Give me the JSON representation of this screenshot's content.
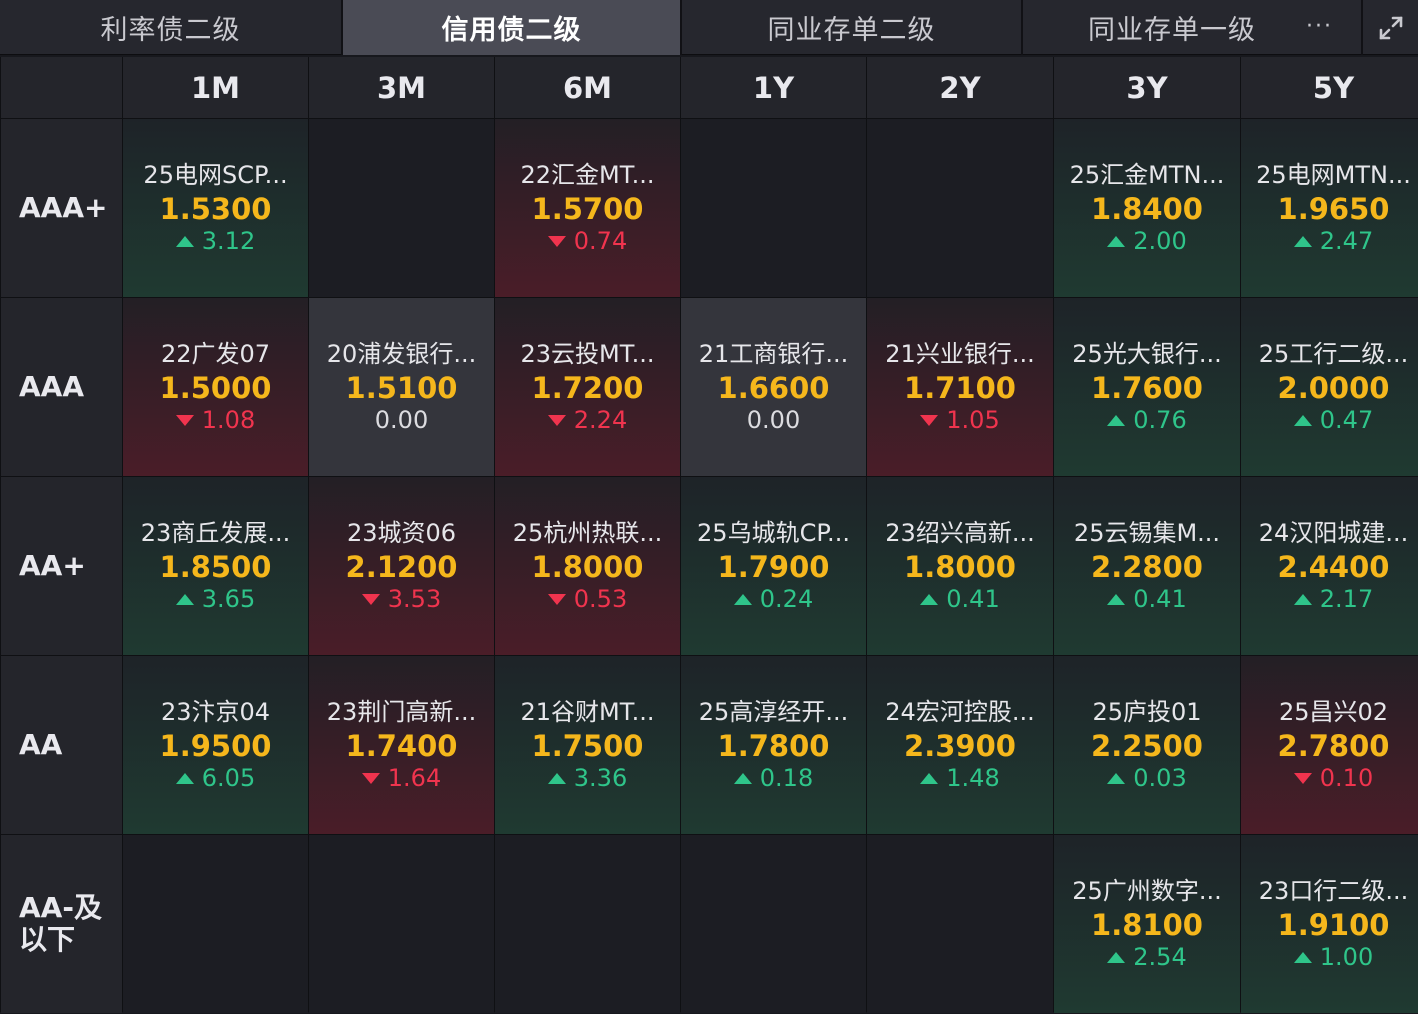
{
  "tabs": [
    "利率债二级",
    "信用债二级",
    "同业存单二级",
    "同业存单一级"
  ],
  "active_tab": 1,
  "more_label": "···",
  "icons": {
    "more": "more-dots-icon",
    "expand": "expand-icon"
  },
  "colors": {
    "value": "#f5b71c",
    "up": "#2fc58a",
    "down": "#f0344e"
  },
  "columns": [
    "1M",
    "3M",
    "6M",
    "1Y",
    "2Y",
    "3Y",
    "5Y"
  ],
  "rows": [
    {
      "label": "AAA+",
      "cells": [
        {
          "name": "25电网SCP...",
          "value": "1.5300",
          "change": "3.12",
          "dir": "up"
        },
        null,
        {
          "name": "22汇金MT...",
          "value": "1.5700",
          "change": "0.74",
          "dir": "down"
        },
        null,
        null,
        {
          "name": "25汇金MTN...",
          "value": "1.8400",
          "change": "2.00",
          "dir": "up"
        },
        {
          "name": "25电网MTN...",
          "value": "1.9650",
          "change": "2.47",
          "dir": "up"
        }
      ]
    },
    {
      "label": "AAA",
      "cells": [
        {
          "name": "22广发07",
          "value": "1.5000",
          "change": "1.08",
          "dir": "down"
        },
        {
          "name": "20浦发银行...",
          "value": "1.5100",
          "change": "0.00",
          "dir": "flat"
        },
        {
          "name": "23云投MT...",
          "value": "1.7200",
          "change": "2.24",
          "dir": "down"
        },
        {
          "name": "21工商银行...",
          "value": "1.6600",
          "change": "0.00",
          "dir": "flat"
        },
        {
          "name": "21兴业银行...",
          "value": "1.7100",
          "change": "1.05",
          "dir": "down"
        },
        {
          "name": "25光大银行...",
          "value": "1.7600",
          "change": "0.76",
          "dir": "up"
        },
        {
          "name": "25工行二级...",
          "value": "2.0000",
          "change": "0.47",
          "dir": "up"
        }
      ]
    },
    {
      "label": "AA+",
      "cells": [
        {
          "name": "23商丘发展...",
          "value": "1.8500",
          "change": "3.65",
          "dir": "up"
        },
        {
          "name": "23城资06",
          "value": "2.1200",
          "change": "3.53",
          "dir": "down"
        },
        {
          "name": "25杭州热联...",
          "value": "1.8000",
          "change": "0.53",
          "dir": "down"
        },
        {
          "name": "25乌城轨CP...",
          "value": "1.7900",
          "change": "0.24",
          "dir": "up"
        },
        {
          "name": "23绍兴高新...",
          "value": "1.8000",
          "change": "0.41",
          "dir": "up"
        },
        {
          "name": "25云锡集M...",
          "value": "2.2800",
          "change": "0.41",
          "dir": "up"
        },
        {
          "name": "24汉阳城建...",
          "value": "2.4400",
          "change": "2.17",
          "dir": "up"
        }
      ]
    },
    {
      "label": "AA",
      "cells": [
        {
          "name": "23汴京04",
          "value": "1.9500",
          "change": "6.05",
          "dir": "up"
        },
        {
          "name": "23荆门高新...",
          "value": "1.7400",
          "change": "1.64",
          "dir": "down"
        },
        {
          "name": "21谷财MT...",
          "value": "1.7500",
          "change": "3.36",
          "dir": "up"
        },
        {
          "name": "25高淳经开...",
          "value": "1.7800",
          "change": "0.18",
          "dir": "up"
        },
        {
          "name": "24宏河控股...",
          "value": "2.3900",
          "change": "1.48",
          "dir": "up"
        },
        {
          "name": "25庐投01",
          "value": "2.2500",
          "change": "0.03",
          "dir": "up"
        },
        {
          "name": "25昌兴02",
          "value": "2.7800",
          "change": "0.10",
          "dir": "down"
        }
      ]
    },
    {
      "label": "AA-及\n以下",
      "label_lines": [
        "AA-及",
        "以下"
      ],
      "cells": [
        null,
        null,
        null,
        null,
        null,
        {
          "name": "25广州数字...",
          "value": "1.8100",
          "change": "2.54",
          "dir": "up"
        },
        {
          "name": "23口行二级...",
          "value": "1.9100",
          "change": "1.00",
          "dir": "up"
        }
      ]
    }
  ]
}
